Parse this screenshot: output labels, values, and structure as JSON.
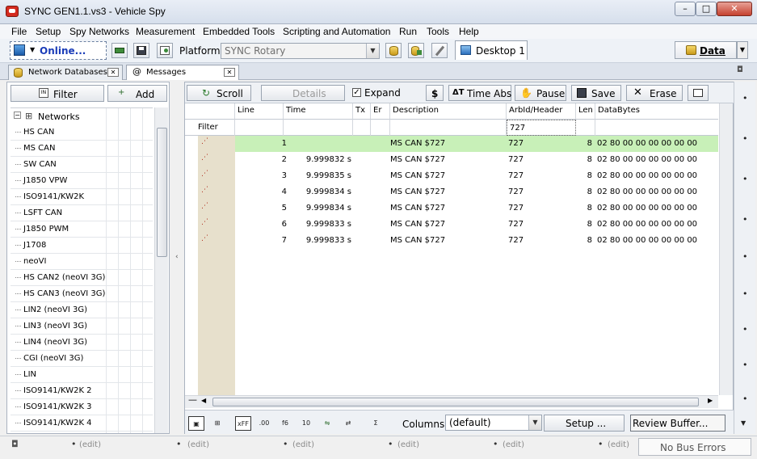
{
  "window": {
    "title": "SYNC GEN1.1.vs3 - Vehicle Spy",
    "minimize": "–",
    "maximize": "□",
    "close": "✕"
  },
  "menu": [
    "File",
    "Setup",
    "Spy Networks",
    "Measurement",
    "Embedded Tools",
    "Scripting and Automation",
    "Run",
    "Tools",
    "Help"
  ],
  "toolbar": {
    "online_label": "Online...",
    "platform_label": "Platform:",
    "platform_value": "SYNC Rotary",
    "desktop_tab": "Desktop 1",
    "data_button": "Data"
  },
  "tabs": [
    {
      "label": "Network Databases",
      "close": "✕"
    },
    {
      "label": "Messages",
      "close": "✕"
    }
  ],
  "left_panel": {
    "filter_button": "Filter",
    "add_button": "Add",
    "tree_root": "Networks",
    "networks": [
      "HS CAN",
      "MS CAN",
      "SW CAN",
      "J1850 VPW",
      "ISO9141/KW2K",
      "LSFT CAN",
      "J1850 PWM",
      "J1708",
      "neoVI",
      "HS CAN2 (neoVI 3G)",
      "HS CAN3 (neoVI 3G)",
      "LIN2 (neoVI 3G)",
      "LIN3 (neoVI 3G)",
      "LIN4 (neoVI 3G)",
      "CGI (neoVI 3G)",
      "LIN",
      "ISO9141/KW2K 2",
      "ISO9141/KW2K 3",
      "ISO9141/KW2K 4"
    ]
  },
  "messages_toolbar": {
    "scroll": "Scroll",
    "details": "Details",
    "expand": "Expand",
    "time_abs": "Time Abs",
    "pause": "Pause",
    "save": "Save",
    "erase": "Erase",
    "expand_checked": "✓"
  },
  "grid": {
    "columns": [
      "Line",
      "Time",
      "Tx",
      "Er",
      "Description",
      "ArbId/Header",
      "Len",
      "DataBytes"
    ],
    "filter_label": "Filter",
    "arbid_filter": "727",
    "rows": [
      {
        "line": "1",
        "time": "",
        "description": "MS CAN $727",
        "arbid": "727",
        "len": "8",
        "data": "02 80 00 00 00 00 00 00",
        "highlight": true
      },
      {
        "line": "2",
        "time": "9.999832 s",
        "description": "MS CAN $727",
        "arbid": "727",
        "len": "8",
        "data": "02 80 00 00 00 00 00 00",
        "highlight": false
      },
      {
        "line": "3",
        "time": "9.999835 s",
        "description": "MS CAN $727",
        "arbid": "727",
        "len": "8",
        "data": "02 80 00 00 00 00 00 00",
        "highlight": false
      },
      {
        "line": "4",
        "time": "9.999834 s",
        "description": "MS CAN $727",
        "arbid": "727",
        "len": "8",
        "data": "02 80 00 00 00 00 00 00",
        "highlight": false
      },
      {
        "line": "5",
        "time": "9.999834 s",
        "description": "MS CAN $727",
        "arbid": "727",
        "len": "8",
        "data": "02 80 00 00 00 00 00 00",
        "highlight": false
      },
      {
        "line": "6",
        "time": "9.999833 s",
        "description": "MS CAN $727",
        "arbid": "727",
        "len": "8",
        "data": "02 80 00 00 00 00 00 00",
        "highlight": false
      },
      {
        "line": "7",
        "time": "9.999833 s",
        "description": "MS CAN $727",
        "arbid": "727",
        "len": "8",
        "data": "02 80 00 00 00 00 00 00",
        "highlight": false
      }
    ]
  },
  "bottom_toolbar": {
    "columns_label": "Columns",
    "columns_value": "(default)",
    "setup_button": "Setup ...",
    "review_button": "Review Buffer...",
    "format_icons": [
      "xFF",
      ".00",
      "f6",
      "10"
    ]
  },
  "status": {
    "edit_label": "(edit)",
    "bus_errors": "No Bus Errors"
  },
  "colors": {
    "highlight_row": "#c8f0b8",
    "online_text": "#1a3cb8"
  }
}
